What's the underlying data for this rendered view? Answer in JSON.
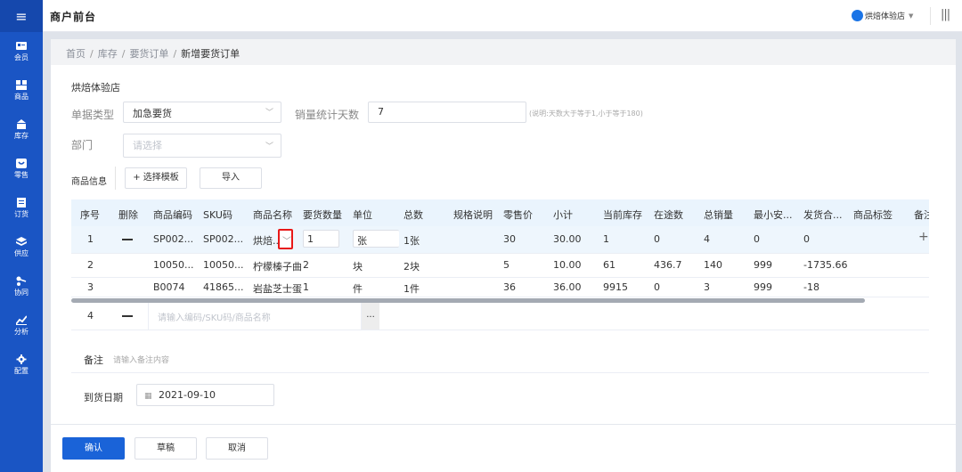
{
  "app": {
    "title": "商户前台",
    "store_switch": "烘焙体验店"
  },
  "sidebar": {
    "items": [
      {
        "label": "会员",
        "icon": "member-card-icon"
      },
      {
        "label": "商品",
        "icon": "grid-icon"
      },
      {
        "label": "库存",
        "icon": "stock-icon"
      },
      {
        "label": "零售",
        "icon": "retail-icon"
      },
      {
        "label": "订货",
        "icon": "order-icon"
      },
      {
        "label": "供应",
        "icon": "supply-icon"
      },
      {
        "label": "协同",
        "icon": "collab-icon"
      },
      {
        "label": "分析",
        "icon": "chart-icon"
      },
      {
        "label": "配置",
        "icon": "gear-icon"
      }
    ]
  },
  "breadcrumb": [
    "首页",
    "库存",
    "要货订单",
    "新增要货订单"
  ],
  "form": {
    "store_name": "烘焙体验店",
    "doc_type_label": "单据类型",
    "doc_type_value": "加急要货",
    "sales_days_label": "销量统计天数",
    "sales_days_value": "7",
    "sales_days_hint": "(说明:天数大于等于1,小于等于180)",
    "dept_label": "部门",
    "dept_placeholder": "请选择",
    "goods_label": "商品信息",
    "template_button": "+ 选择模板",
    "import_button": "导入"
  },
  "table": {
    "columns": [
      "序号",
      "删除",
      "商品编码",
      "SKU码",
      "商品名称",
      "要货数量",
      "单位",
      "总数",
      "规格说明",
      "零售价",
      "小计",
      "当前库存",
      "在途数",
      "总销量",
      "最小安...",
      "发货合...",
      "商品标签",
      "备注"
    ],
    "rows": [
      {
        "no": "1",
        "code": "SP002...",
        "sku": "SP002...",
        "name": "烘焙...",
        "qty": "1",
        "unit": "张",
        "total": "1张",
        "spec": "",
        "price": "30",
        "subtotal": "30.00",
        "stock": "1",
        "transit": "0",
        "sales": "4",
        "min_safe": "0",
        "ship": "0",
        "tag": "",
        "remark": "+"
      },
      {
        "no": "2",
        "code": "10050...",
        "sku": "10050...",
        "name": "柠檬榛子曲",
        "qty": "2",
        "unit": "块",
        "total": "2块",
        "spec": "",
        "price": "5",
        "subtotal": "10.00",
        "stock": "61",
        "transit": "436.7",
        "sales": "140",
        "min_safe": "999",
        "ship": "-1735.66",
        "tag": "",
        "remark": ""
      },
      {
        "no": "3",
        "code": "B0074",
        "sku": "41865...",
        "name": "岩盐芝士蛋",
        "qty": "1",
        "unit": "件",
        "total": "1件",
        "spec": "",
        "price": "36",
        "subtotal": "36.00",
        "stock": "9915",
        "transit": "0",
        "sales": "3",
        "min_safe": "999",
        "ship": "-18",
        "tag": "",
        "remark": ""
      }
    ],
    "new_row": {
      "no": "4",
      "placeholder": "请输入编码/SKU码/商品名称",
      "more": "..."
    }
  },
  "remark": {
    "label": "备注",
    "placeholder": "请输入备注内容"
  },
  "arrival": {
    "label": "到货日期",
    "value": "2021-09-10"
  },
  "actions": {
    "confirm": "确认",
    "draft": "草稿",
    "cancel": "取消"
  }
}
